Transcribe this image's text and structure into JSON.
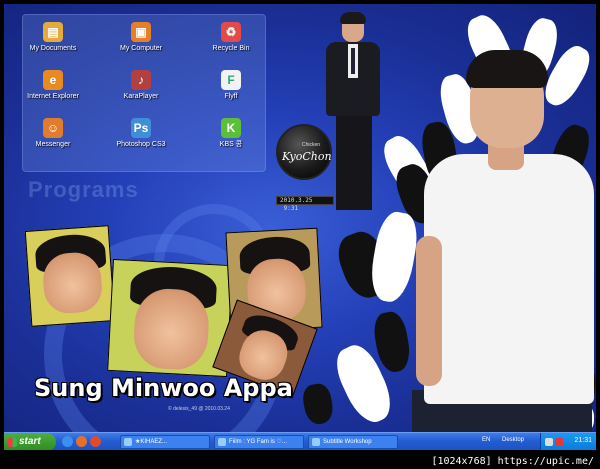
{
  "desktop": {
    "icons": [
      {
        "label": "My Documents",
        "icon": "folder-documents-icon",
        "color": "#e6a93b"
      },
      {
        "label": "My Computer",
        "icon": "computer-icon",
        "color": "#e57f2a"
      },
      {
        "label": "Recycle Bin",
        "icon": "recycle-bin-icon",
        "color": "#e34a4a"
      },
      {
        "label": "Internet Explorer",
        "icon": "internet-explorer-icon",
        "color": "#e88a1f"
      },
      {
        "label": "KaraPlayer",
        "icon": "music-player-icon",
        "color": "#b34040"
      },
      {
        "label": "Flyff",
        "icon": "flyff-game-icon",
        "color": "#f2f2f2"
      },
      {
        "label": "Messenger",
        "icon": "messenger-icon",
        "color": "#e07c2c"
      },
      {
        "label": "Photoshop CS3",
        "icon": "photoshop-icon",
        "color": "#3f8fd6"
      },
      {
        "label": "KBS 콩",
        "icon": "kbs-icon",
        "color": "#5bbf3a"
      }
    ],
    "programs_label": "Programs",
    "caption": "Sung Minwoo Appa",
    "signature": "© delesis_49 @ 2010.03.24",
    "clock_widget": {
      "brand_small": "Chicken",
      "brand": "KyoChon",
      "date": "2010.3.25",
      "time": "9:31"
    }
  },
  "taskbar": {
    "start_label": "start",
    "tasks": [
      {
        "label": "★KIHAEZ..."
      },
      {
        "label": "Fiilm : YG Fam is ♡..."
      },
      {
        "label": "Subtitle Workshop"
      }
    ],
    "language": "EN",
    "desktop_label": "Desktop",
    "clock": "21:31"
  },
  "watermark": "[1024x768] https://upic.me/"
}
